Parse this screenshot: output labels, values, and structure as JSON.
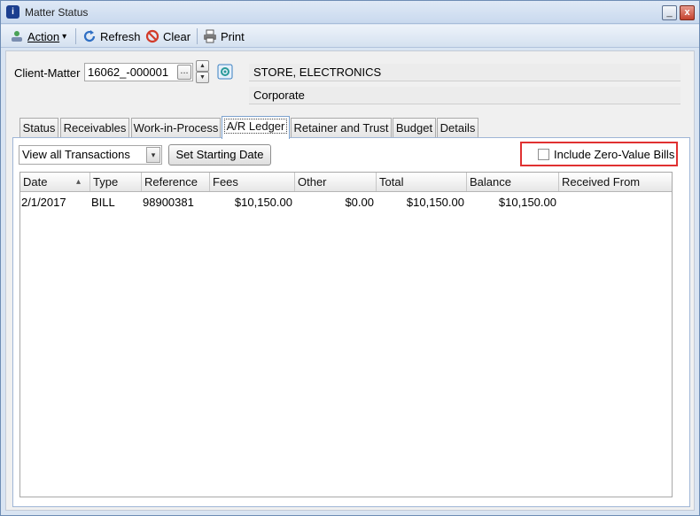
{
  "window": {
    "title": "Matter Status",
    "icon_label": "i",
    "minimize_glyph": "_",
    "maximize_glyph": "□",
    "close_glyph": "x"
  },
  "toolbar": {
    "action_label": "Action",
    "action_caret": "▾",
    "refresh_label": "Refresh",
    "clear_label": "Clear",
    "print_label": "Print"
  },
  "client_matter": {
    "label": "Client-Matter",
    "value": "16062_-000001",
    "browse_glyph": "...",
    "spin_up_glyph": "▲",
    "spin_down_glyph": "▼",
    "client_name": "STORE, ELECTRONICS",
    "matter_name": "Corporate"
  },
  "tabs": [
    {
      "label": "Status"
    },
    {
      "label": "Receivables"
    },
    {
      "label": "Work-in-Process"
    },
    {
      "label": "A/R Ledger"
    },
    {
      "label": "Retainer and Trust"
    },
    {
      "label": "Budget"
    },
    {
      "label": "Details"
    }
  ],
  "ledger": {
    "filter_value": "View all Transactions",
    "filter_arrow": "▾",
    "set_starting_date_label": "Set Starting Date",
    "include_zero_label": "Include Zero-Value Bills",
    "sort_glyph": "▴",
    "columns": [
      "Date",
      "Type",
      "Reference",
      "Fees",
      "Other",
      "Total",
      "Balance",
      "Received From"
    ],
    "rows": [
      {
        "date": "2/1/2017",
        "type": "BILL",
        "reference": "98900381",
        "fees": "$10,150.00",
        "other": "$0.00",
        "total": "$10,150.00",
        "balance": "$10,150.00",
        "received_from": ""
      }
    ]
  },
  "colors": {
    "highlight": "#e03131",
    "active_tab_border": "#7da2ce",
    "title_bar": "#c9d9ee"
  }
}
